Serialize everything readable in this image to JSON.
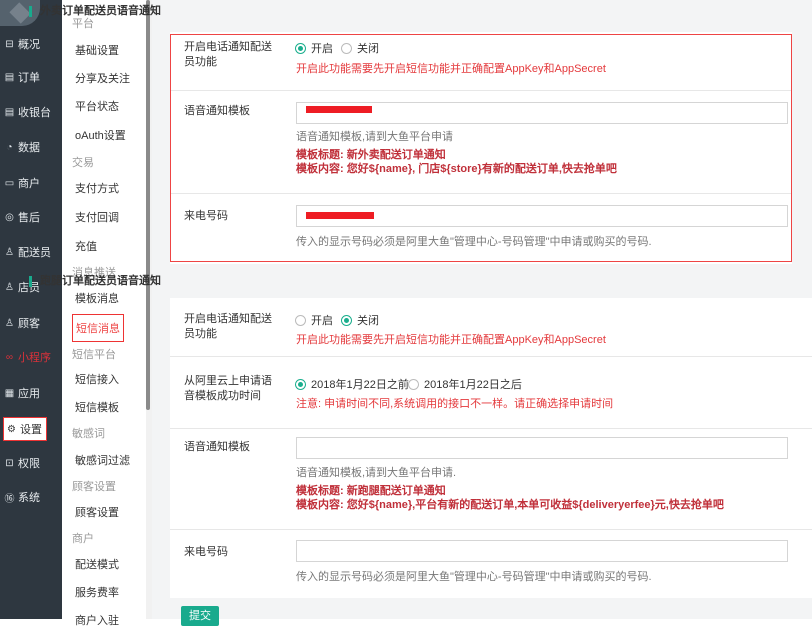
{
  "sidebar": {
    "items": [
      {
        "label": "概况",
        "icon": "dashboard-icon",
        "glyph": "⊟"
      },
      {
        "label": "订单",
        "icon": "order-icon",
        "glyph": "▤"
      },
      {
        "label": "收银台",
        "icon": "cashier-icon",
        "glyph": "▤"
      },
      {
        "label": "数据",
        "icon": "data-icon",
        "glyph": "◔"
      },
      {
        "label": "商户",
        "icon": "merchant-icon",
        "glyph": "▭"
      },
      {
        "label": "售后",
        "icon": "aftersale-icon",
        "glyph": "◎"
      },
      {
        "label": "配送员",
        "icon": "courier-icon",
        "glyph": "♙"
      },
      {
        "label": "店员",
        "icon": "clerk-icon",
        "glyph": "♙"
      },
      {
        "label": "顾客",
        "icon": "customer-icon",
        "glyph": "♙"
      },
      {
        "label": "小程序",
        "icon": "miniapp-icon",
        "glyph": "∞"
      },
      {
        "label": "应用",
        "icon": "apps-icon",
        "glyph": "▦"
      },
      {
        "label": "设置",
        "icon": "settings-icon",
        "glyph": "⚙"
      },
      {
        "label": "权限",
        "icon": "permission-icon",
        "glyph": "⊡"
      },
      {
        "label": "系统",
        "icon": "system-icon",
        "glyph": "⑯"
      }
    ]
  },
  "subnav": {
    "groups": {
      "platform": "平台",
      "trade": "交易",
      "msg": "消息推送",
      "sms_platform": "短信平台",
      "sensitive": "敏感词",
      "customer_settings": "顾客设置",
      "merchant": "商户"
    },
    "items": {
      "basic": "基础设置",
      "share": "分享及关注",
      "status": "平台状态",
      "oauth": "oAuth设置",
      "pay": "支付方式",
      "callback": "支付回调",
      "recharge": "充值",
      "tpl_msg": "模板消息",
      "sms_msg": "短信消息",
      "sms_access": "短信接入",
      "sms_tpl": "短信模板",
      "filter": "敏感词过滤",
      "customer_set": "顾客设置",
      "delivery": "配送模式",
      "service_fee": "服务费率",
      "merchant_entry": "商户入驻"
    }
  },
  "takeaway": {
    "title": "外卖订单配送员语音通知",
    "enable_label": "开启电话通知配送员功能",
    "on_label": "开启",
    "off_label": "关闭",
    "enable_hint": "开启此功能需要先开启短信功能并正确配置AppKey和AppSecret",
    "tpl_label": "语音通知模板",
    "tpl_hint": "语音通知模板,请到大鱼平台申请",
    "tpl_title": "模板标题: 新外卖配送订单通知",
    "tpl_content": "模板内容: 您好${name}, 门店${store}有新的配送订单,快去抢单吧",
    "caller_label": "来电号码",
    "caller_hint": "传入的显示号码必须是阿里大鱼\"管理中心-号码管理\"中申请或购买的号码."
  },
  "errand": {
    "title": "跑腿订单配送员语音通知",
    "enable_label": "开启电话通知配送员功能",
    "on_label": "开启",
    "off_label": "关闭",
    "enable_hint": "开启此功能需要先开启短信功能并正确配置AppKey和AppSecret",
    "apply_label": "从阿里云上申请语音模板成功时间",
    "before_label": "2018年1月22日之前",
    "after_label": "2018年1月22日之后",
    "apply_hint": "注意: 申请时间不同,系统调用的接口不一样。请正确选择申请时间",
    "tpl_label": "语音通知模板",
    "tpl_hint": "语音通知模板,请到大鱼平台申请.",
    "tpl_title": "模板标题: 新跑腿配送订单通知",
    "tpl_content": "模板内容: 您好${name},平台有新的配送订单,本单可收益${deliveryerfee}元,快去抢单吧",
    "caller_label": "来电号码",
    "caller_hint": "传入的显示号码必须是阿里大鱼\"管理中心-号码管理\"中申请或购买的号码."
  },
  "buttons": {
    "submit": "提交"
  },
  "colors": {
    "accent": "#19aa8d",
    "danger": "#e4393c",
    "sidebar": "#2e3740"
  }
}
